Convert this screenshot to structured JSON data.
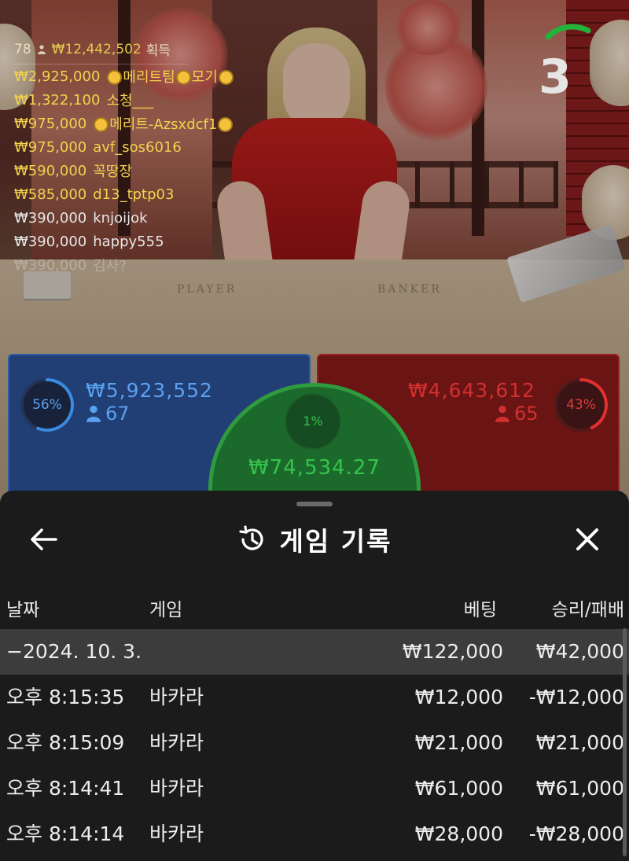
{
  "timer": {
    "seconds": "3",
    "remaining_fraction": 0.2,
    "color": "#22b33a"
  },
  "leaderboard": {
    "header": {
      "count": "78",
      "amount": "₩12,442,502",
      "suffix": "획득"
    },
    "rows": [
      {
        "amount": "₩2,925,000",
        "name": "메리트팀",
        "name2": "모기",
        "badge": "sun"
      },
      {
        "amount": "₩1,322,100",
        "name": "소청___"
      },
      {
        "amount": "₩975,000",
        "name": "메리트-Azsxdcf1",
        "badge": "sun"
      },
      {
        "amount": "₩975,000",
        "name": "avf_sos6016"
      },
      {
        "amount": "₩590,000",
        "name": "꼭땅장"
      },
      {
        "amount": "₩585,000",
        "name": "d13_tptp03"
      },
      {
        "amount": "₩390,000",
        "name": "knjoijok"
      },
      {
        "amount": "₩390,000",
        "name": "happy555"
      },
      {
        "amount": "₩390,000",
        "name": "김사?"
      }
    ]
  },
  "table": {
    "player_label": "PLAYER",
    "banker_label": "BANKER"
  },
  "bets": {
    "player": {
      "percent": "56%",
      "percent_value": 56,
      "amount": "₩5,923,552",
      "count": "67",
      "color": "#3a8ae0"
    },
    "banker": {
      "percent": "43%",
      "percent_value": 43,
      "amount": "₩4,643,612",
      "count": "65",
      "color": "#e03030"
    },
    "tie": {
      "percent": "1%",
      "percent_value": 1,
      "amount": "₩74,534.27",
      "color": "#35c34d"
    }
  },
  "history": {
    "title": "게임 기록",
    "back_icon": "arrow-left-icon",
    "close_icon": "close-icon",
    "title_icon": "history-icon",
    "columns": {
      "date": "날짜",
      "game": "게임",
      "bet": "베팅",
      "result": "승리/패배"
    },
    "summary": {
      "date": "−2024. 10. 3.",
      "bet": "₩122,000",
      "result": "₩42,000"
    },
    "rows": [
      {
        "time": "오후 8:15:35",
        "game": "바카라",
        "bet": "₩12,000",
        "result": "-₩12,000"
      },
      {
        "time": "오후 8:15:09",
        "game": "바카라",
        "bet": "₩21,000",
        "result": "₩21,000"
      },
      {
        "time": "오후 8:14:41",
        "game": "바카라",
        "bet": "₩61,000",
        "result": "₩61,000"
      },
      {
        "time": "오후 8:14:14",
        "game": "바카라",
        "bet": "₩28,000",
        "result": "-₩28,000"
      }
    ]
  }
}
